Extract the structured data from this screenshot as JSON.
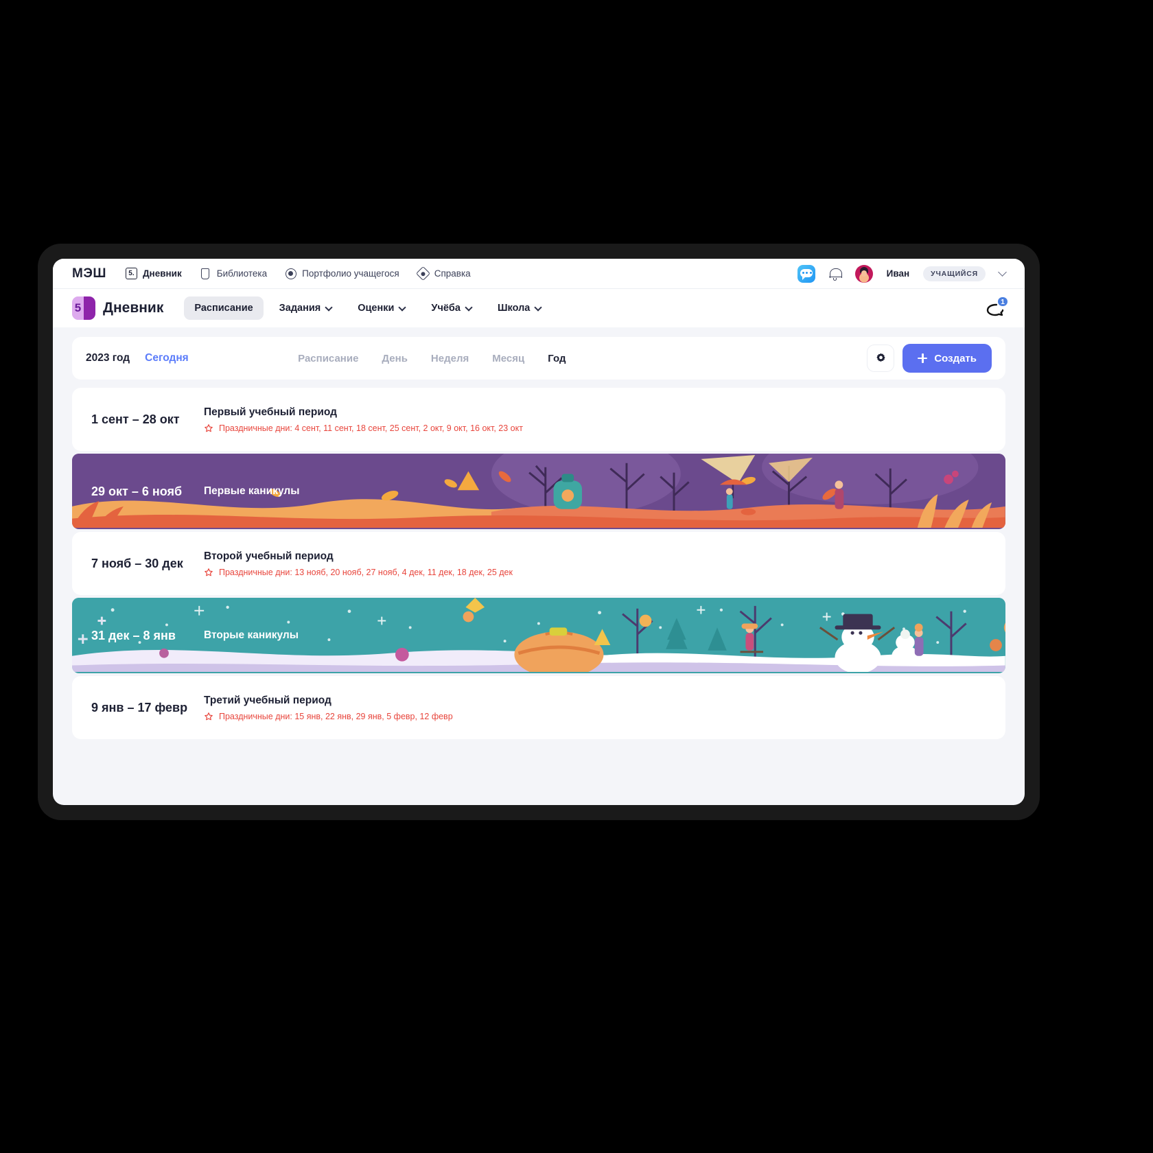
{
  "topbar": {
    "brand": "МЭШ",
    "nav": [
      {
        "label": "Дневник",
        "icon": "diary-icon",
        "glyph": "5.",
        "active": true
      },
      {
        "label": "Библиотека",
        "icon": "book-icon",
        "active": false
      },
      {
        "label": "Портфолио учащегося",
        "icon": "portfolio-circle-icon",
        "active": false
      },
      {
        "label": "Справка",
        "icon": "help-diamond-icon",
        "active": false
      }
    ],
    "chat_icon": "chat-icon",
    "bell_icon": "bell-icon",
    "user_name": "Иван",
    "user_role": "УЧАЩИЙСЯ",
    "user_chevron": "chevron-down-icon"
  },
  "navbar": {
    "logo_glyph": "5",
    "title": "Дневник",
    "items": [
      {
        "label": "Расписание",
        "has_chevron": false,
        "selected": true
      },
      {
        "label": "Задания",
        "has_chevron": true,
        "selected": false
      },
      {
        "label": "Оценки",
        "has_chevron": true,
        "selected": false
      },
      {
        "label": "Учёба",
        "has_chevron": true,
        "selected": false
      },
      {
        "label": "Школа",
        "has_chevron": true,
        "selected": false
      }
    ],
    "reply_icon": "reply-chat-icon",
    "badge_count": "1",
    "badge_color": "#4a7fe0"
  },
  "toolbar": {
    "year": "2023 год",
    "today": "Сегодня",
    "views": [
      {
        "label": "Расписание",
        "active": false
      },
      {
        "label": "День",
        "active": false
      },
      {
        "label": "Неделя",
        "active": false
      },
      {
        "label": "Месяц",
        "active": false
      },
      {
        "label": "Год",
        "active": true
      }
    ],
    "settings_icon": "gear-icon",
    "create_label": "Создать",
    "create_icon": "plus-icon",
    "create_color": "#5b6ff0"
  },
  "periods": [
    {
      "kind": "study",
      "dates": "1 сент – 28 окт",
      "title": "Первый учебный период",
      "holidays": "Праздничные дни: 4 сент, 11 сент, 18 сент, 25 сент, 2 окт, 9 окт, 16 окт, 23 окт",
      "holiday_icon": "star-icon",
      "holiday_color": "#e8453c"
    },
    {
      "kind": "vacation-autumn",
      "dates": "29 окт – 6 нояб",
      "title": "Первые каникулы"
    },
    {
      "kind": "study",
      "dates": "7 нояб – 30 дек",
      "title": "Второй учебный период",
      "holidays": "Праздничные дни: 13 нояб, 20 нояб, 27 нояб, 4 дек, 11 дек, 18 дек, 25 дек",
      "holiday_icon": "star-icon",
      "holiday_color": "#e8453c"
    },
    {
      "kind": "vacation-winter",
      "dates": "31 дек – 8 янв",
      "title": "Вторые каникулы"
    },
    {
      "kind": "study",
      "dates": "9 янв – 17 февр",
      "title": "Третий учебный период",
      "holidays": "Праздничные дни: 15 янв, 22 янв, 29 янв, 5 февр, 12 февр",
      "holiday_icon": "star-icon",
      "holiday_color": "#e8453c"
    }
  ]
}
